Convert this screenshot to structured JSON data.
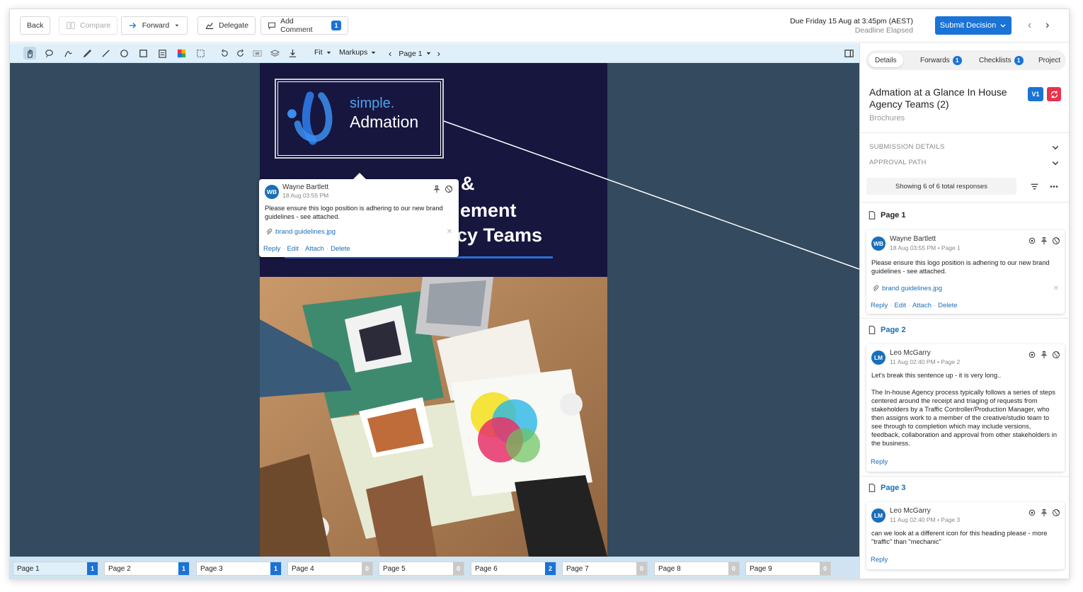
{
  "topbar": {
    "back_label": "Back",
    "compare_label": "Compare",
    "forward_label": "Forward",
    "delegate_label": "Delegate",
    "add_comment_label": "Add Comment",
    "add_comment_count": "1",
    "due_text": "Due Friday 15 Aug at 3:45pm (AEST)",
    "deadline_text": "Deadline Elapsed",
    "submit_label": "Submit Decision"
  },
  "toolbar": {
    "fit_label": "Fit",
    "markups_label": "Markups",
    "page_label": "Page 1"
  },
  "document": {
    "logo_line1": "simple.",
    "logo_line2": "Admation",
    "title_line1": "&",
    "title_line2": "ement",
    "title_line3": "cy Teams"
  },
  "popup_comment": {
    "initials": "WB",
    "author": "Wayne Bartlett",
    "date": "18 Aug 03:55 PM",
    "text": "Please ensure this logo position is adhering to our new brand guidelines - see attached.",
    "attachment": "brand guidelines.jpg",
    "actions": [
      "Reply",
      "Edit",
      "Attach",
      "Delete"
    ]
  },
  "pages": [
    {
      "label": "Page 1",
      "count": "1"
    },
    {
      "label": "Page 2",
      "count": "1"
    },
    {
      "label": "Page 3",
      "count": "1"
    },
    {
      "label": "Page 4",
      "count": "0"
    },
    {
      "label": "Page 5",
      "count": "0"
    },
    {
      "label": "Page 6",
      "count": "2"
    },
    {
      "label": "Page 7",
      "count": "0"
    },
    {
      "label": "Page 8",
      "count": "0"
    },
    {
      "label": "Page 9",
      "count": "0"
    }
  ],
  "panel": {
    "tabs": [
      {
        "label": "Details",
        "count": ""
      },
      {
        "label": "Forwards",
        "count": "1"
      },
      {
        "label": "Checklists",
        "count": "1"
      },
      {
        "label": "Project",
        "count": ""
      }
    ],
    "title": "Admation at a Glance In House Agency Teams (2)",
    "category": "Brochures",
    "version": "V1",
    "submission_details": "SUBMISSION DETAILS",
    "approval_path": "APPROVAL PATH",
    "showing": "Showing 6 of 6 total responses",
    "groups": [
      {
        "page": "Page 1",
        "comment": {
          "initials": "WB",
          "author": "Wayne Bartlett",
          "meta": "18 Aug 03:55 PM • Page 1",
          "text": "Please ensure this logo position is adhering to our new brand guidelines - see attached.",
          "attachment": "brand guidelines.jpg",
          "actions": [
            "Reply",
            "Edit",
            "Attach",
            "Delete"
          ]
        }
      },
      {
        "page": "Page 2",
        "comment": {
          "initials": "LM",
          "author": "Leo McGarry",
          "meta": "11 Aug 02:40 PM • Page 2",
          "text1": "Let's break this sentence up - it is very long..",
          "text2": "The In-house Agency process typically follows a series of steps centered around the receipt and triaging of requests from stakeholders by a Traffic Controller/Production Manager, who then assigns work to a member of the creative/studio team to see through to completion which may include versions, feedback, collaboration and approval from other stakeholders in the business.",
          "reply": "Reply"
        }
      },
      {
        "page": "Page 3",
        "comment": {
          "initials": "LM",
          "author": "Leo McGarry",
          "meta": "11 Aug 02:40 PM • Page 3",
          "text": "can we look at a different icon for this heading please - more \"traffic\" than \"mechanic\"",
          "reply": "Reply"
        }
      }
    ]
  },
  "colors": {
    "accent": "#1a73d6",
    "doc_bg": "#16163f",
    "viewer_bg": "#344a5e",
    "toolbar_bg": "#dff0fb",
    "refresh": "#e8334a"
  }
}
